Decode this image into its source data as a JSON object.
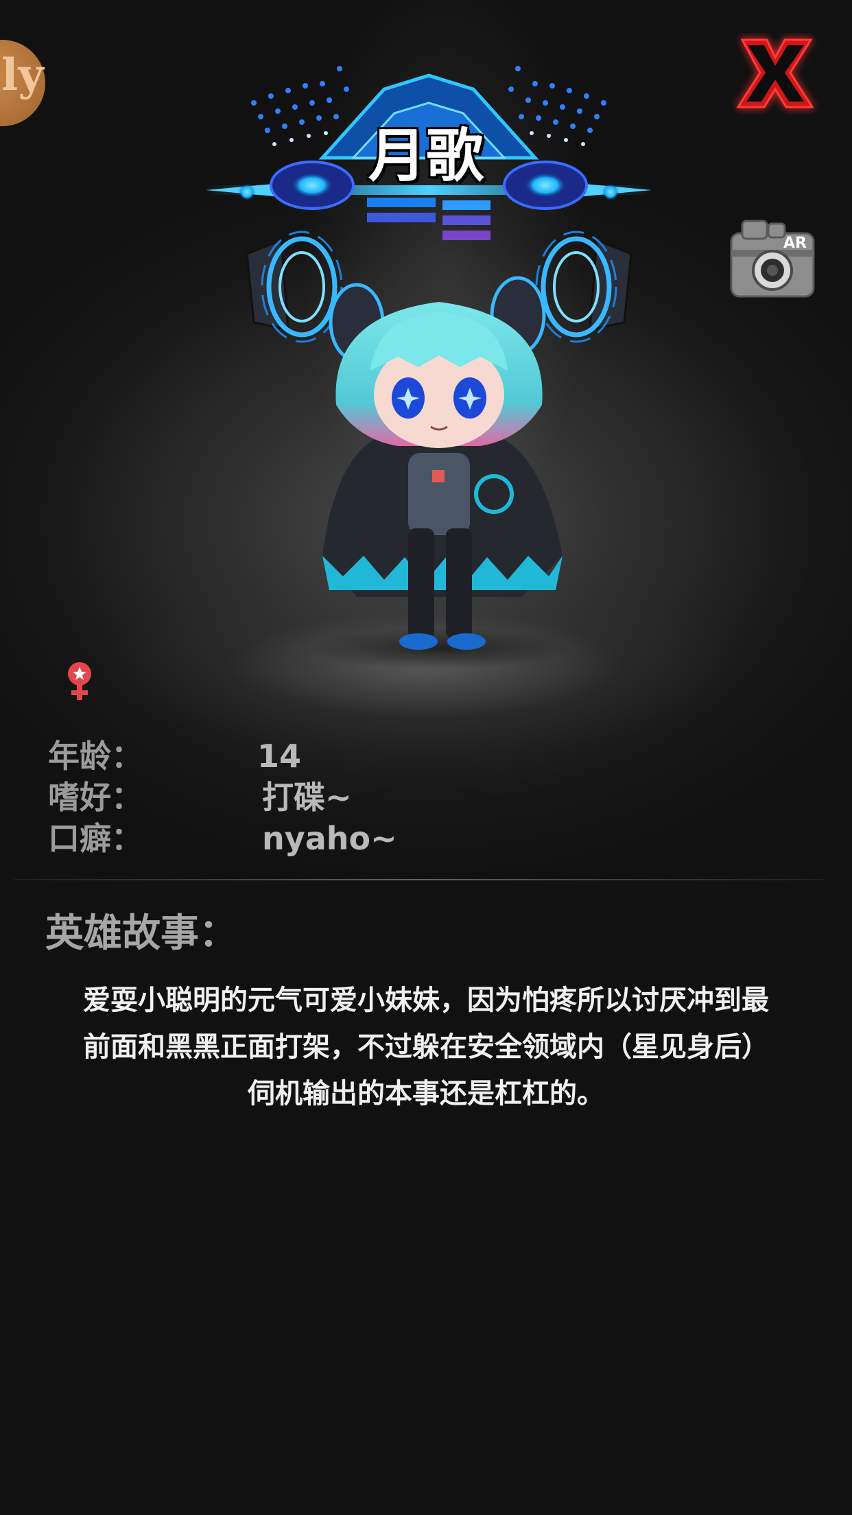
{
  "hero": {
    "name": "月歌"
  },
  "buttons": {
    "close_icon": "close-x-icon",
    "ar_camera_icon": "ar-camera-icon",
    "ar_label": "AR",
    "back_glyph": "ly"
  },
  "profile": {
    "gender_icon": "female-icon",
    "gender_color": "#e2464b",
    "age_label": "年龄：",
    "age_value": "14",
    "hobby_label": "嗜好：",
    "hobby_value": "打碟~",
    "catchphrase_label": "口癖：",
    "catchphrase_value": "nyaho~"
  },
  "story": {
    "title": "英雄故事：",
    "lines": [
      "爱耍小聪明的元气可爱小妹妹，因为怕疼所以讨厌冲到最",
      "前面和黑黑正面打架，不过躲在安全领域内（星见身后）",
      "伺机输出的本事还是杠杠的。"
    ]
  },
  "colors": {
    "accent_blue": "#1fb6ff",
    "close_red": "#d11919",
    "background": "#111111"
  }
}
